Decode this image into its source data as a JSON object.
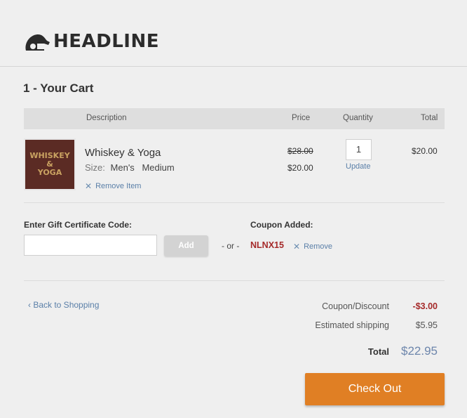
{
  "header": {
    "logo_text": "HEADLINE"
  },
  "cart": {
    "title": "1 - Your Cart",
    "columns": {
      "description": "Description",
      "price": "Price",
      "quantity": "Quantity",
      "total": "Total"
    },
    "item": {
      "image_text_line1": "WHISKEY",
      "image_text_line2": "&",
      "image_text_line3": "YOGA",
      "name": "Whiskey & Yoga",
      "size_label": "Size:",
      "size_value1": "Men's",
      "size_value2": "Medium",
      "remove_label": "Remove Item",
      "price_original": "$28.00",
      "price_sale": "$20.00",
      "quantity": "1",
      "update_label": "Update",
      "line_total": "$20.00"
    }
  },
  "gift": {
    "label": "Enter Gift Certificate Code:",
    "input_value": "",
    "add_label": "Add",
    "or_text": "- or -"
  },
  "coupon": {
    "label": "Coupon Added:",
    "code": "NLNX15",
    "remove_label": "Remove"
  },
  "back_link": "‹ Back to Shopping",
  "summary": {
    "coupon_label": "Coupon/Discount",
    "coupon_value": "-$3.00",
    "shipping_label": "Estimated shipping",
    "shipping_value": "$5.95",
    "total_label": "Total",
    "total_value": "$22.95"
  },
  "checkout_label": "Check Out",
  "colors": {
    "accent": "#e07f24",
    "link": "#5a7fa8",
    "discount": "#a52a2a",
    "total": "#6d86ac"
  }
}
